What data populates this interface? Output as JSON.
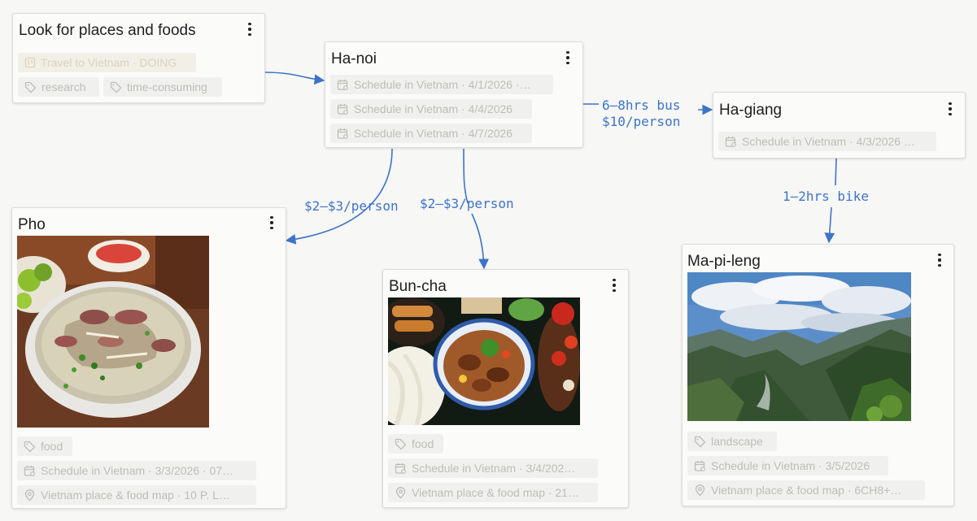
{
  "cards": {
    "look": {
      "title": "Look for places and foods",
      "project": "Travel to Vietnam · DOING",
      "tags": [
        "research",
        "time-consuming"
      ]
    },
    "hanoi": {
      "title": "Ha-noi",
      "schedules": [
        "Schedule in Vietnam · 4/1/2026 ·…",
        "Schedule in Vietnam · 4/4/2026",
        "Schedule in Vietnam · 4/7/2026"
      ]
    },
    "hagiang": {
      "title": "Ha-giang",
      "schedules": [
        "Schedule in Vietnam · 4/3/2026 …"
      ]
    },
    "pho": {
      "title": "Pho",
      "image": "pho-soup-photo",
      "tag": "food",
      "schedule": "Schedule in Vietnam · 3/3/2026 · 07…",
      "place": "Vietnam place & food map · 10 P. L…"
    },
    "buncha": {
      "title": "Bun-cha",
      "image": "bun-cha-photo",
      "tag": "food",
      "schedule": "Schedule in Vietnam · 3/4/202…",
      "place": "Vietnam place & food map · 21…"
    },
    "mapileng": {
      "title": "Ma-pi-leng",
      "image": "mountain-landscape-photo",
      "tag": "landscape",
      "schedule": "Schedule in Vietnam · 3/5/2026",
      "place": "Vietnam place & food map · 6CH8+…"
    }
  },
  "edges": {
    "hanoi_hagiang": [
      "6–8hrs bus",
      "$10/person"
    ],
    "hanoi_pho": "$2–$3/person",
    "hanoi_buncha": "$2–$3/person",
    "hagiang_mapileng": "1–2hrs bike"
  },
  "icons": {
    "menu": "more-vertical-icon",
    "tag": "tag-icon",
    "calendar": "calendar-icon",
    "place": "map-pin-icon",
    "project": "board-icon"
  },
  "colors": {
    "edge": "#3d73c9",
    "chip_text": "#bdbdb8"
  }
}
